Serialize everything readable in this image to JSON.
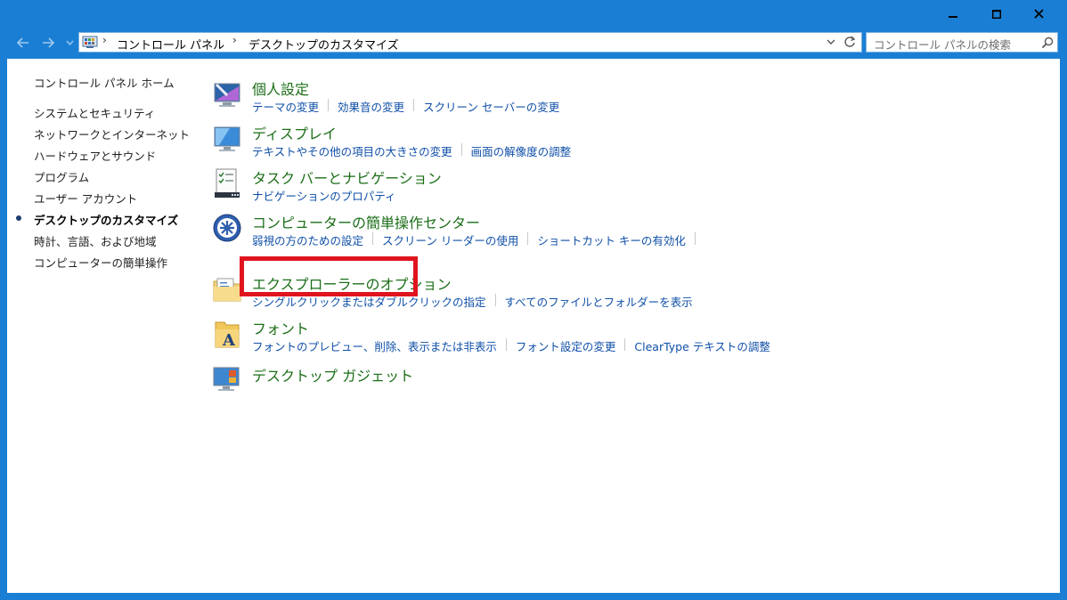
{
  "window": {
    "accent_color": "#1a7fd4",
    "minimize_icon": "minimize-icon",
    "maximize_icon": "maximize-icon",
    "close_icon": "close-icon"
  },
  "address": {
    "crumbs": [
      "コントロール パネル",
      "デスクトップのカスタマイズ"
    ],
    "search_placeholder": "コントロール パネルの検索"
  },
  "sidebar": {
    "home": "コントロール パネル ホーム",
    "items": [
      {
        "label": "システムとセキュリティ"
      },
      {
        "label": "ネットワークとインターネット"
      },
      {
        "label": "ハードウェアとサウンド"
      },
      {
        "label": "プログラム"
      },
      {
        "label": "ユーザー アカウント"
      },
      {
        "label": "デスクトップのカスタマイズ",
        "current": true
      },
      {
        "label": "時計、言語、および地域"
      },
      {
        "label": "コンピューターの簡単操作"
      }
    ]
  },
  "categories": [
    {
      "title": "個人設定",
      "links": [
        "テーマの変更",
        "効果音の変更",
        "スクリーン セーバーの変更"
      ]
    },
    {
      "title": "ディスプレイ",
      "links": [
        "テキストやその他の項目の大きさの変更",
        "画面の解像度の調整"
      ]
    },
    {
      "title": "タスク バーとナビゲーション",
      "links": [
        "ナビゲーションのプロパティ"
      ]
    },
    {
      "title": "コンピューターの簡単操作センター",
      "links": [
        "弱視の方のための設定",
        "スクリーン リーダーの使用",
        "ショートカット キーの有効化"
      ]
    },
    {
      "title": "エクスプローラーのオプション",
      "links": [
        "シングルクリックまたはダブルクリックの指定",
        "すべてのファイルとフォルダーを表示"
      ]
    },
    {
      "title": "フォント",
      "links": [
        "フォントのプレビュー、削除、表示または非表示",
        "フォント設定の変更",
        "ClearType テキストの調整"
      ]
    },
    {
      "title": "デスクトップ ガジェット",
      "links": []
    }
  ],
  "highlight_color": "#e0141e"
}
